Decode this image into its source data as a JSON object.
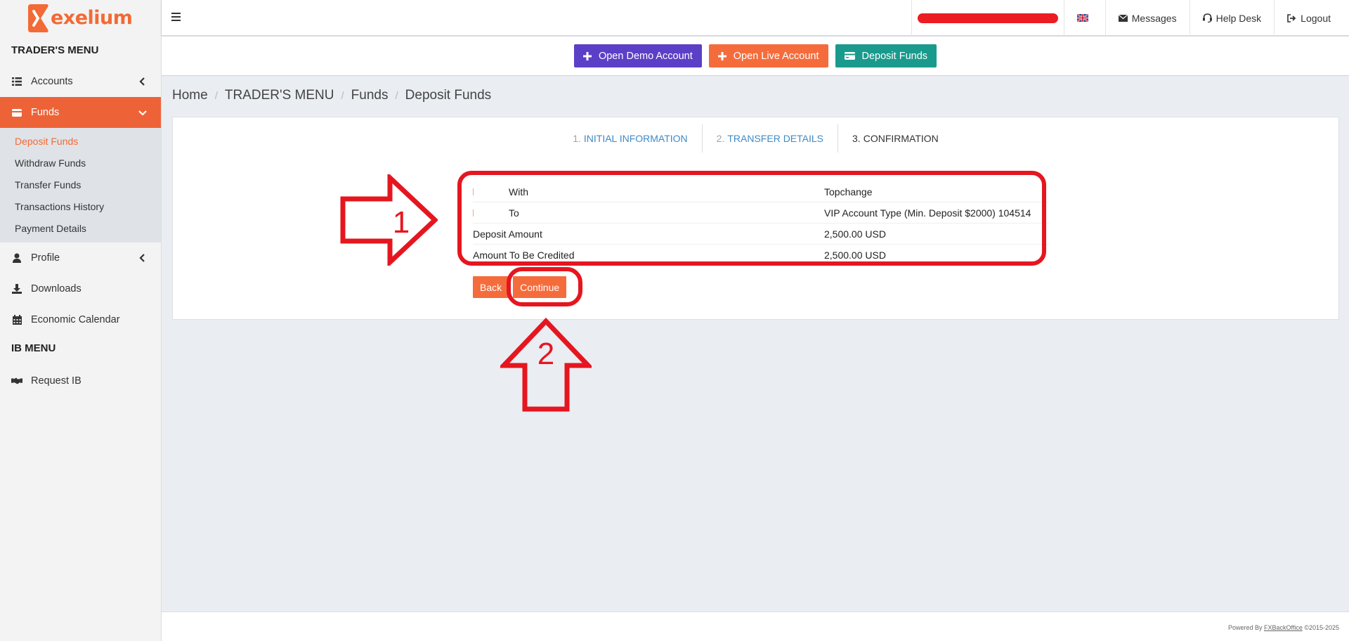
{
  "brand": {
    "name": "exelium",
    "color": "#f26a35"
  },
  "sidebar": {
    "traders_header": "TRADER'S MENU",
    "items": [
      {
        "label": "Accounts",
        "icon": "list-icon"
      },
      {
        "label": "Funds",
        "icon": "wallet-icon"
      },
      {
        "label": "Profile",
        "icon": "user-icon"
      },
      {
        "label": "Downloads",
        "icon": "download-icon"
      },
      {
        "label": "Economic Calendar",
        "icon": "calendar-icon"
      }
    ],
    "funds_submenu": [
      {
        "label": "Deposit Funds"
      },
      {
        "label": "Withdraw Funds"
      },
      {
        "label": "Transfer Funds"
      },
      {
        "label": "Transactions History"
      },
      {
        "label": "Payment Details"
      }
    ],
    "ib_header": "IB MENU",
    "ib_items": [
      {
        "label": "Request IB",
        "icon": "handshake-icon"
      }
    ]
  },
  "topbar": {
    "messages": "Messages",
    "help_desk": "Help Desk",
    "logout": "Logout",
    "language_icon": "uk-flag-icon"
  },
  "actions": {
    "demo": "Open Demo Account",
    "live": "Open Live Account",
    "deposit": "Deposit Funds"
  },
  "breadcrumb": [
    "Home",
    "TRADER'S MENU",
    "Funds",
    "Deposit Funds"
  ],
  "steps": [
    {
      "num": "1.",
      "label": "INITIAL INFORMATION"
    },
    {
      "num": "2.",
      "label": "TRANSFER DETAILS"
    },
    {
      "num": "3.",
      "label": "CONFIRMATION"
    }
  ],
  "confirmation": {
    "rows": [
      {
        "label": "With",
        "value": "Topchange"
      },
      {
        "label": "To",
        "value": "VIP Account Type (Min. Deposit $2000) 104514"
      },
      {
        "label": "Deposit Amount",
        "value": "2,500.00 USD"
      },
      {
        "label": "Amount To Be Credited",
        "value": "2,500.00 USD"
      }
    ],
    "back": "Back",
    "continue": "Continue"
  },
  "annotations": {
    "one": "1",
    "two": "2",
    "color": "#e5161f"
  },
  "footer": {
    "prefix": "Powered By ",
    "link": "FXBackOffice",
    "suffix": " ©2015-2025"
  }
}
